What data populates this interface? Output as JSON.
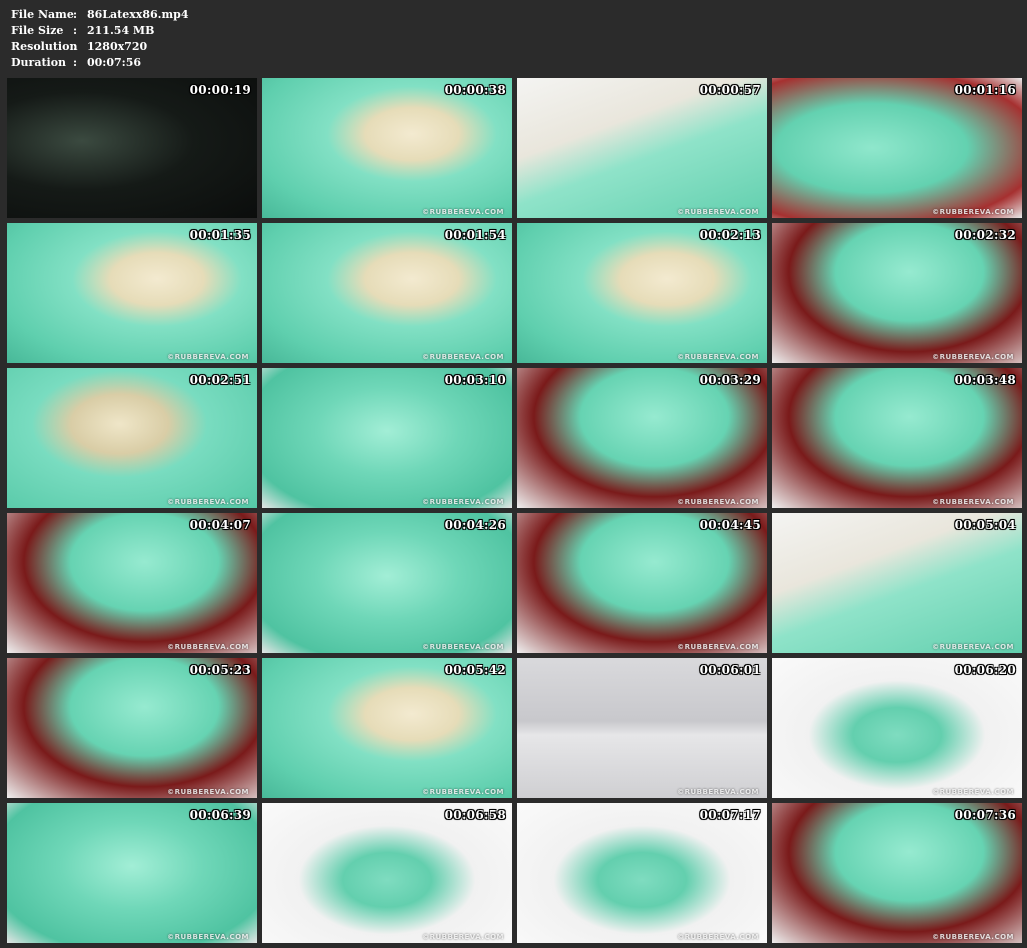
{
  "header": {
    "rows": [
      {
        "label": "File Name",
        "colon": ":",
        "value": "86Latexx86.mp4"
      },
      {
        "label": "File Size",
        "colon": ":",
        "value": "211.54 MB"
      },
      {
        "label": "Resolution",
        "colon": ":",
        "value": "1280x720"
      },
      {
        "label": "Duration",
        "colon": ":",
        "value": "00:07:56"
      }
    ]
  },
  "watermark": "©RUBBEREVA.COM",
  "thumbnails": [
    {
      "time": "00:00:19",
      "scene": "dark"
    },
    {
      "time": "00:00:38",
      "scene": "gloves-green"
    },
    {
      "time": "00:00:57",
      "scene": "corset-white"
    },
    {
      "time": "00:01:16",
      "scene": "green-red-chair"
    },
    {
      "time": "00:01:35",
      "scene": "gloves-green"
    },
    {
      "time": "00:01:54",
      "scene": "gloves-green"
    },
    {
      "time": "00:02:13",
      "scene": "gloves-green"
    },
    {
      "time": "00:02:32",
      "scene": "hood-red"
    },
    {
      "time": "00:02:51",
      "scene": "corset-green"
    },
    {
      "time": "00:03:10",
      "scene": "green-body"
    },
    {
      "time": "00:03:29",
      "scene": "hood-red"
    },
    {
      "time": "00:03:48",
      "scene": "hood-red"
    },
    {
      "time": "00:04:07",
      "scene": "hood-red"
    },
    {
      "time": "00:04:26",
      "scene": "green-body"
    },
    {
      "time": "00:04:45",
      "scene": "hood-red"
    },
    {
      "time": "00:05:04",
      "scene": "corset-white"
    },
    {
      "time": "00:05:23",
      "scene": "hood-red"
    },
    {
      "time": "00:05:42",
      "scene": "gloves-green"
    },
    {
      "time": "00:06:01",
      "scene": "room-grey"
    },
    {
      "time": "00:06:20",
      "scene": "white-room"
    },
    {
      "time": "00:06:39",
      "scene": "green-body"
    },
    {
      "time": "00:06:58",
      "scene": "white-room"
    },
    {
      "time": "00:07:17",
      "scene": "white-room"
    },
    {
      "time": "00:07:36",
      "scene": "hood-red"
    }
  ]
}
